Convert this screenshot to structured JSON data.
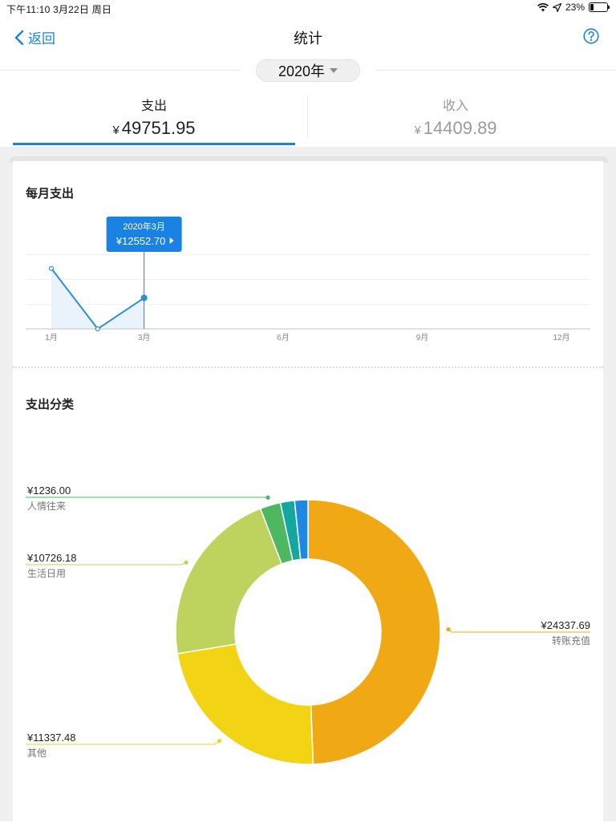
{
  "status_bar": {
    "time_date": "下午11:10   3月22日 周日",
    "battery": "23%",
    "battery_level": 0.23
  },
  "nav": {
    "back_label": "返回",
    "title": "统计"
  },
  "year_selector": {
    "value": "2020年"
  },
  "tabs": [
    {
      "label": "支出",
      "currency": "¥",
      "amount": "49751.95",
      "active": true
    },
    {
      "label": "收入",
      "currency": "¥",
      "amount": "14409.89",
      "active": false
    }
  ],
  "monthly": {
    "title": "每月支出",
    "tooltip": {
      "month": "2020年3月",
      "value": "¥12552.70"
    }
  },
  "category": {
    "title": "支出分类"
  },
  "colors": {
    "accent": "#1a82e2",
    "line": "#2e8fd6",
    "transfer": "#f0a814",
    "other": "#f2d414",
    "daily": "#bdd35e",
    "social": "#4db860",
    "teal": "#14a7a0",
    "blue": "#1e88e5"
  },
  "chart_data": [
    {
      "type": "line",
      "title": "每月支出",
      "x": [
        1,
        2,
        3
      ],
      "x_tick_labels": [
        "1月",
        "3月",
        "6月",
        "9月",
        "12月"
      ],
      "x_tick_values": [
        1,
        3,
        6,
        9,
        12
      ],
      "xlim": [
        1,
        12
      ],
      "values": [
        24500,
        0,
        12552.7
      ],
      "ylim": [
        0,
        40000
      ],
      "grid": true,
      "highlight": {
        "x": 3,
        "label_month": "2020年3月",
        "label_value": "¥12552.70"
      }
    },
    {
      "type": "pie",
      "title": "支出分类",
      "slices": [
        {
          "name": "转账充值",
          "amount": "¥24337.69",
          "value": 24337.69,
          "color": "#f0a814",
          "labeled": true
        },
        {
          "name": "其他",
          "amount": "¥11337.48",
          "value": 11337.48,
          "color": "#f2d414",
          "labeled": true
        },
        {
          "name": "生活日用",
          "amount": "¥10726.18",
          "value": 10726.18,
          "color": "#bdd35e",
          "labeled": true
        },
        {
          "name": "人情往来",
          "amount": "¥1236.00",
          "value": 1236.0,
          "color": "#4db860",
          "labeled": true
        },
        {
          "name": "",
          "amount": "",
          "value": 850,
          "color": "#14a7a0",
          "labeled": false
        },
        {
          "name": "",
          "amount": "",
          "value": 800,
          "color": "#1e88e5",
          "labeled": false
        }
      ]
    }
  ]
}
